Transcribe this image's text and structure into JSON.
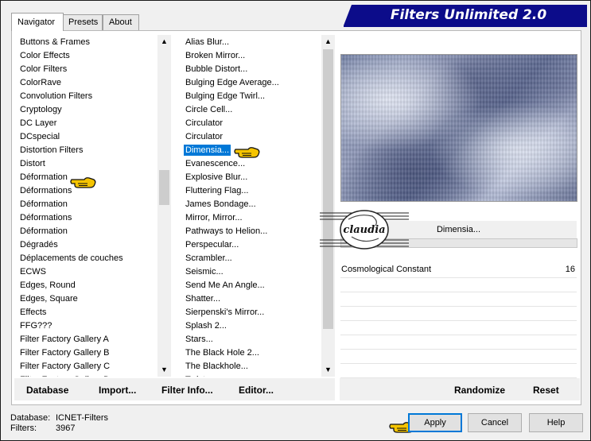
{
  "window": {
    "title": "Filters Unlimited 2.0",
    "tabs": [
      {
        "label": "Navigator",
        "active": true
      },
      {
        "label": "Presets",
        "active": false
      },
      {
        "label": "About",
        "active": false
      }
    ]
  },
  "categories": {
    "items": [
      "Buttons & Frames",
      "Color Effects",
      "Color Filters",
      "ColorRave",
      "Convolution Filters",
      "Cryptology",
      "DC Layer",
      "DCspecial",
      "Distortion Filters",
      "Distort",
      "Déformation",
      "Déformations",
      "Déformation",
      "Déformations",
      "Déformation",
      "Dégradés",
      "Déplacements de couches",
      "ECWS",
      "Edges, Round",
      "Edges, Square",
      "Effects",
      "FFG???",
      "Filter Factory Gallery A",
      "Filter Factory Gallery B",
      "Filter Factory Gallery C",
      "Filter Factory Gallery D"
    ],
    "pointed_index": 10
  },
  "filters": {
    "items": [
      "Alias Blur...",
      "Broken Mirror...",
      "Bubble Distort...",
      "Bulging Edge Average...",
      "Bulging Edge Twirl...",
      "Circle Cell...",
      "Circulator",
      "Circulator",
      "Dimensia...",
      "Evanescence...",
      "Explosive Blur...",
      "Fluttering Flag...",
      "James Bondage...",
      "Mirror, Mirror...",
      "Pathways to Helion...",
      "Perspecular...",
      "Scrambler...",
      "Seismic...",
      "Send Me An Angle...",
      "Shatter...",
      "Sierpenski's Mirror...",
      "Splash 2...",
      "Stars...",
      "The Black Hole 2...",
      "The Blackhole...",
      "Twister..."
    ],
    "selected_index": 8
  },
  "preview": {
    "filter_name": "Dimensia...",
    "params": [
      {
        "label": "Cosmological Constant",
        "value": "16"
      }
    ]
  },
  "bottom_left_buttons": {
    "database": "Database",
    "import": "Import...",
    "filter_info": "Filter Info...",
    "editor": "Editor..."
  },
  "bottom_right_buttons": {
    "randomize": "Randomize",
    "reset": "Reset"
  },
  "status": {
    "database_label": "Database:",
    "database_value": "ICNET-Filters",
    "filters_label": "Filters:",
    "filters_value": "3967"
  },
  "dialog_buttons": {
    "apply": "Apply",
    "cancel": "Cancel",
    "help": "Help"
  },
  "watermark": {
    "text": "claudia"
  },
  "colors": {
    "title_bar": "#0c0c8a",
    "selection": "#0078d7",
    "pointer_hand": "#f5c400"
  },
  "icons": {
    "pointer": "pointing-hand-icon",
    "scroll_up": "chevron-up-icon",
    "scroll_down": "chevron-down-icon"
  }
}
